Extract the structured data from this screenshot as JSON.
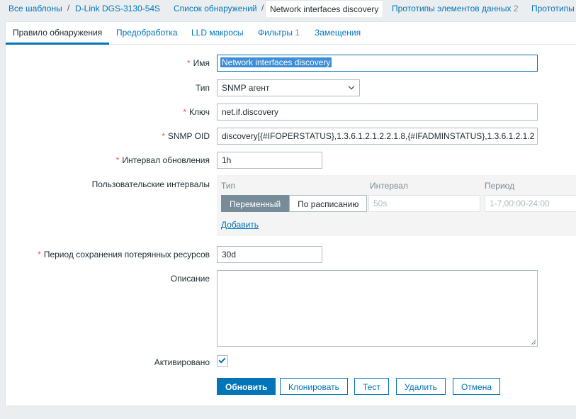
{
  "breadcrumbs": {
    "all_templates": "Все шаблоны",
    "host": "D-Link DGS-3130-54S",
    "discovery_list": "Список обнаружений",
    "current": "Network interfaces discovery",
    "item_prototypes": "Прототипы элементов данных",
    "item_prototypes_count": "2",
    "prototypes_more": "Прототипы"
  },
  "tabs": {
    "discovery_rule": "Правило обнаружения",
    "preprocessing": "Предобработка",
    "lld_macros": "LLD макросы",
    "filters": "Фильтры",
    "filters_count": "1",
    "overrides": "Замещения"
  },
  "form": {
    "name_label": "Имя",
    "name_value": "Network interfaces discovery",
    "type_label": "Тип",
    "type_value": "SNMP агент",
    "key_label": "Ключ",
    "key_value": "net.if.discovery",
    "snmp_oid_label": "SNMP OID",
    "snmp_oid_value": "discovery[{#IFOPERSTATUS},1.3.6.1.2.1.2.2.1.8,{#IFADMINSTATUS},1.3.6.1.2.1.2",
    "update_interval_label": "Интервал обновления",
    "update_interval_value": "1h",
    "custom_intervals_label": "Пользовательские интервалы",
    "custom_intervals": {
      "col_type": "Тип",
      "col_interval": "Интервал",
      "col_period": "Период",
      "type_flexible": "Переменный",
      "type_scheduling": "По расписанию",
      "interval_placeholder": "50s",
      "period_placeholder": "1-7,00:00-24:00",
      "add_link": "Добавить"
    },
    "keep_lost_label": "Период сохранения потерянных ресурсов",
    "keep_lost_value": "30d",
    "description_label": "Описание",
    "description_value": "",
    "enabled_label": "Активировано",
    "enabled": true
  },
  "buttons": {
    "update": "Обновить",
    "clone": "Клонировать",
    "test": "Тест",
    "delete": "Удалить",
    "cancel": "Отмена"
  },
  "colors": {
    "accent": "#0275b8",
    "required": "#e45959",
    "background": "#ebeef0"
  }
}
